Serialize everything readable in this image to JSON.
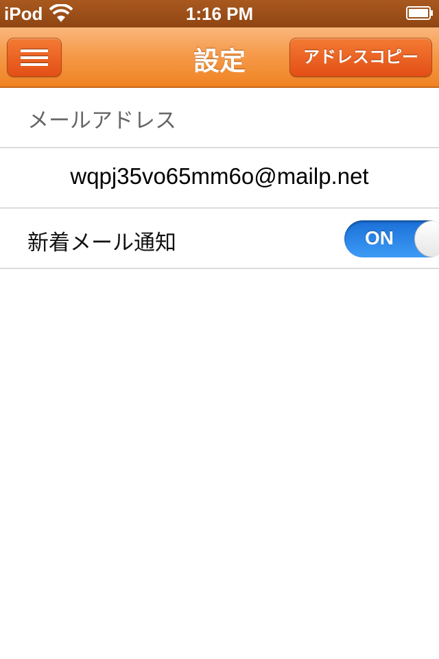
{
  "status_bar": {
    "carrier": "iPod",
    "time": "1:16 PM",
    "wifi_icon": "wifi-icon",
    "battery_icon": "battery-icon"
  },
  "nav_bar": {
    "menu_icon": "hamburger-icon",
    "title": "設定",
    "copy_button_label": "アドレスコピー",
    "accent_color": "#f08323"
  },
  "settings": {
    "email_section_label": "メールアドレス",
    "email_address": "wqpj35vo65mm6o@mailp.net",
    "notification_label": "新着メール通知",
    "notification_toggle": {
      "state": "ON",
      "color": "#2a86e8"
    }
  }
}
